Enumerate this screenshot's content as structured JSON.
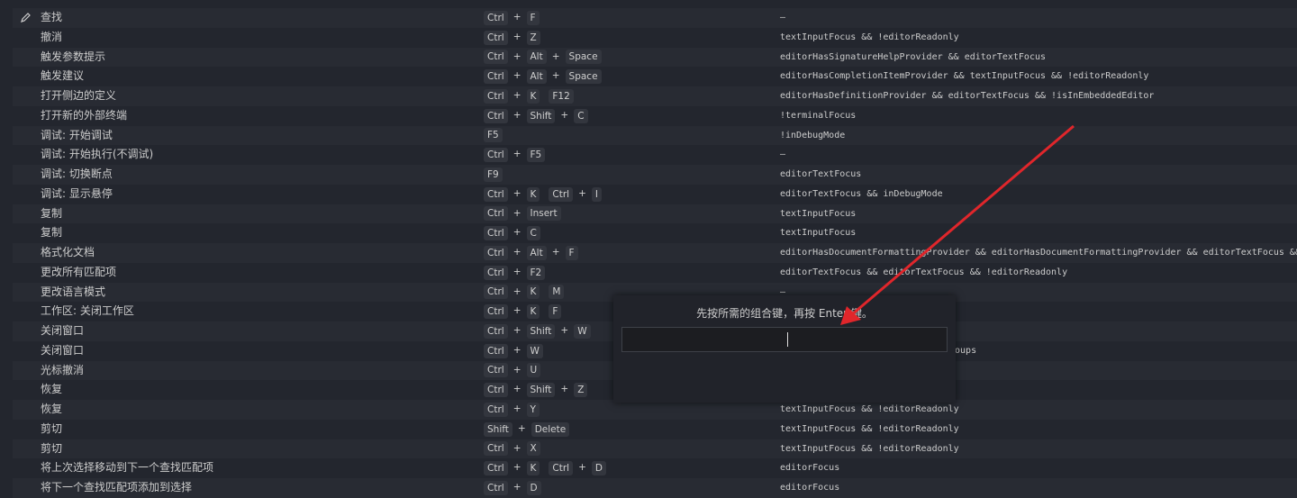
{
  "rows": [
    {
      "command": "查找",
      "keys": [
        [
          "Ctrl",
          "F"
        ]
      ],
      "when": "—",
      "edit": true
    },
    {
      "command": "撤消",
      "keys": [
        [
          "Ctrl",
          "Z"
        ]
      ],
      "when": "textInputFocus && !editorReadonly"
    },
    {
      "command": "触发参数提示",
      "keys": [
        [
          "Ctrl",
          "Alt",
          "Space"
        ]
      ],
      "when": "editorHasSignatureHelpProvider && editorTextFocus"
    },
    {
      "command": "触发建议",
      "keys": [
        [
          "Ctrl",
          "Alt",
          "Space"
        ]
      ],
      "when": "editorHasCompletionItemProvider && textInputFocus && !editorReadonly"
    },
    {
      "command": "打开侧边的定义",
      "keys": [
        [
          "Ctrl",
          "K"
        ],
        [
          "F12"
        ]
      ],
      "when": "editorHasDefinitionProvider && editorTextFocus && !isInEmbeddedEditor"
    },
    {
      "command": "打开新的外部终端",
      "keys": [
        [
          "Ctrl",
          "Shift",
          "C"
        ]
      ],
      "when": "!terminalFocus"
    },
    {
      "command": "调试: 开始调试",
      "keys": [
        [
          "F5"
        ]
      ],
      "when": "!inDebugMode"
    },
    {
      "command": "调试: 开始执行(不调试)",
      "keys": [
        [
          "Ctrl",
          "F5"
        ]
      ],
      "when": "—"
    },
    {
      "command": "调试: 切换断点",
      "keys": [
        [
          "F9"
        ]
      ],
      "when": "editorTextFocus"
    },
    {
      "command": "调试: 显示悬停",
      "keys": [
        [
          "Ctrl",
          "K"
        ],
        [
          "Ctrl",
          "I"
        ]
      ],
      "when": "editorTextFocus && inDebugMode"
    },
    {
      "command": "复制",
      "keys": [
        [
          "Ctrl",
          "Insert"
        ]
      ],
      "when": "textInputFocus"
    },
    {
      "command": "复制",
      "keys": [
        [
          "Ctrl",
          "C"
        ]
      ],
      "when": "textInputFocus"
    },
    {
      "command": "格式化文档",
      "keys": [
        [
          "Ctrl",
          "Alt",
          "F"
        ]
      ],
      "when": "editorHasDocumentFormattingProvider && editorHasDocumentFormattingProvider && editorTextFocus && !e"
    },
    {
      "command": "更改所有匹配项",
      "keys": [
        [
          "Ctrl",
          "F2"
        ]
      ],
      "when": "editorTextFocus && editorTextFocus && !editorReadonly"
    },
    {
      "command": "更改语言模式",
      "keys": [
        [
          "Ctrl",
          "K"
        ],
        [
          "M"
        ]
      ],
      "when": "—"
    },
    {
      "command": "工作区: 关闭工作区",
      "keys": [
        [
          "Ctrl",
          "K"
        ],
        [
          "F"
        ]
      ],
      "when": ""
    },
    {
      "command": "关闭窗口",
      "keys": [
        [
          "Ctrl",
          "Shift",
          "W"
        ]
      ],
      "when": ""
    },
    {
      "command": "关闭窗口",
      "keys": [
        [
          "Ctrl",
          "W"
        ]
      ],
      "when": "roups",
      "offset": true
    },
    {
      "command": "光标撤消",
      "keys": [
        [
          "Ctrl",
          "U"
        ]
      ],
      "when": ""
    },
    {
      "command": "恢复",
      "keys": [
        [
          "Ctrl",
          "Shift",
          "Z"
        ]
      ],
      "when": ""
    },
    {
      "command": "恢复",
      "keys": [
        [
          "Ctrl",
          "Y"
        ]
      ],
      "when": "textInputFocus && !editorReadonly"
    },
    {
      "command": "剪切",
      "keys": [
        [
          "Shift",
          "Delete"
        ]
      ],
      "when": "textInputFocus && !editorReadonly"
    },
    {
      "command": "剪切",
      "keys": [
        [
          "Ctrl",
          "X"
        ]
      ],
      "when": "textInputFocus && !editorReadonly"
    },
    {
      "command": "将上次选择移动到下一个查找匹配项",
      "keys": [
        [
          "Ctrl",
          "K"
        ],
        [
          "Ctrl",
          "D"
        ]
      ],
      "when": "editorFocus"
    },
    {
      "command": "将下一个查找匹配项添加到选择",
      "keys": [
        [
          "Ctrl",
          "D"
        ]
      ],
      "when": "editorFocus"
    }
  ],
  "modal": {
    "message": "先按所需的组合键，再按 Enter 键。",
    "input_value": ""
  },
  "colors": {
    "arrow": "#e0262b"
  }
}
